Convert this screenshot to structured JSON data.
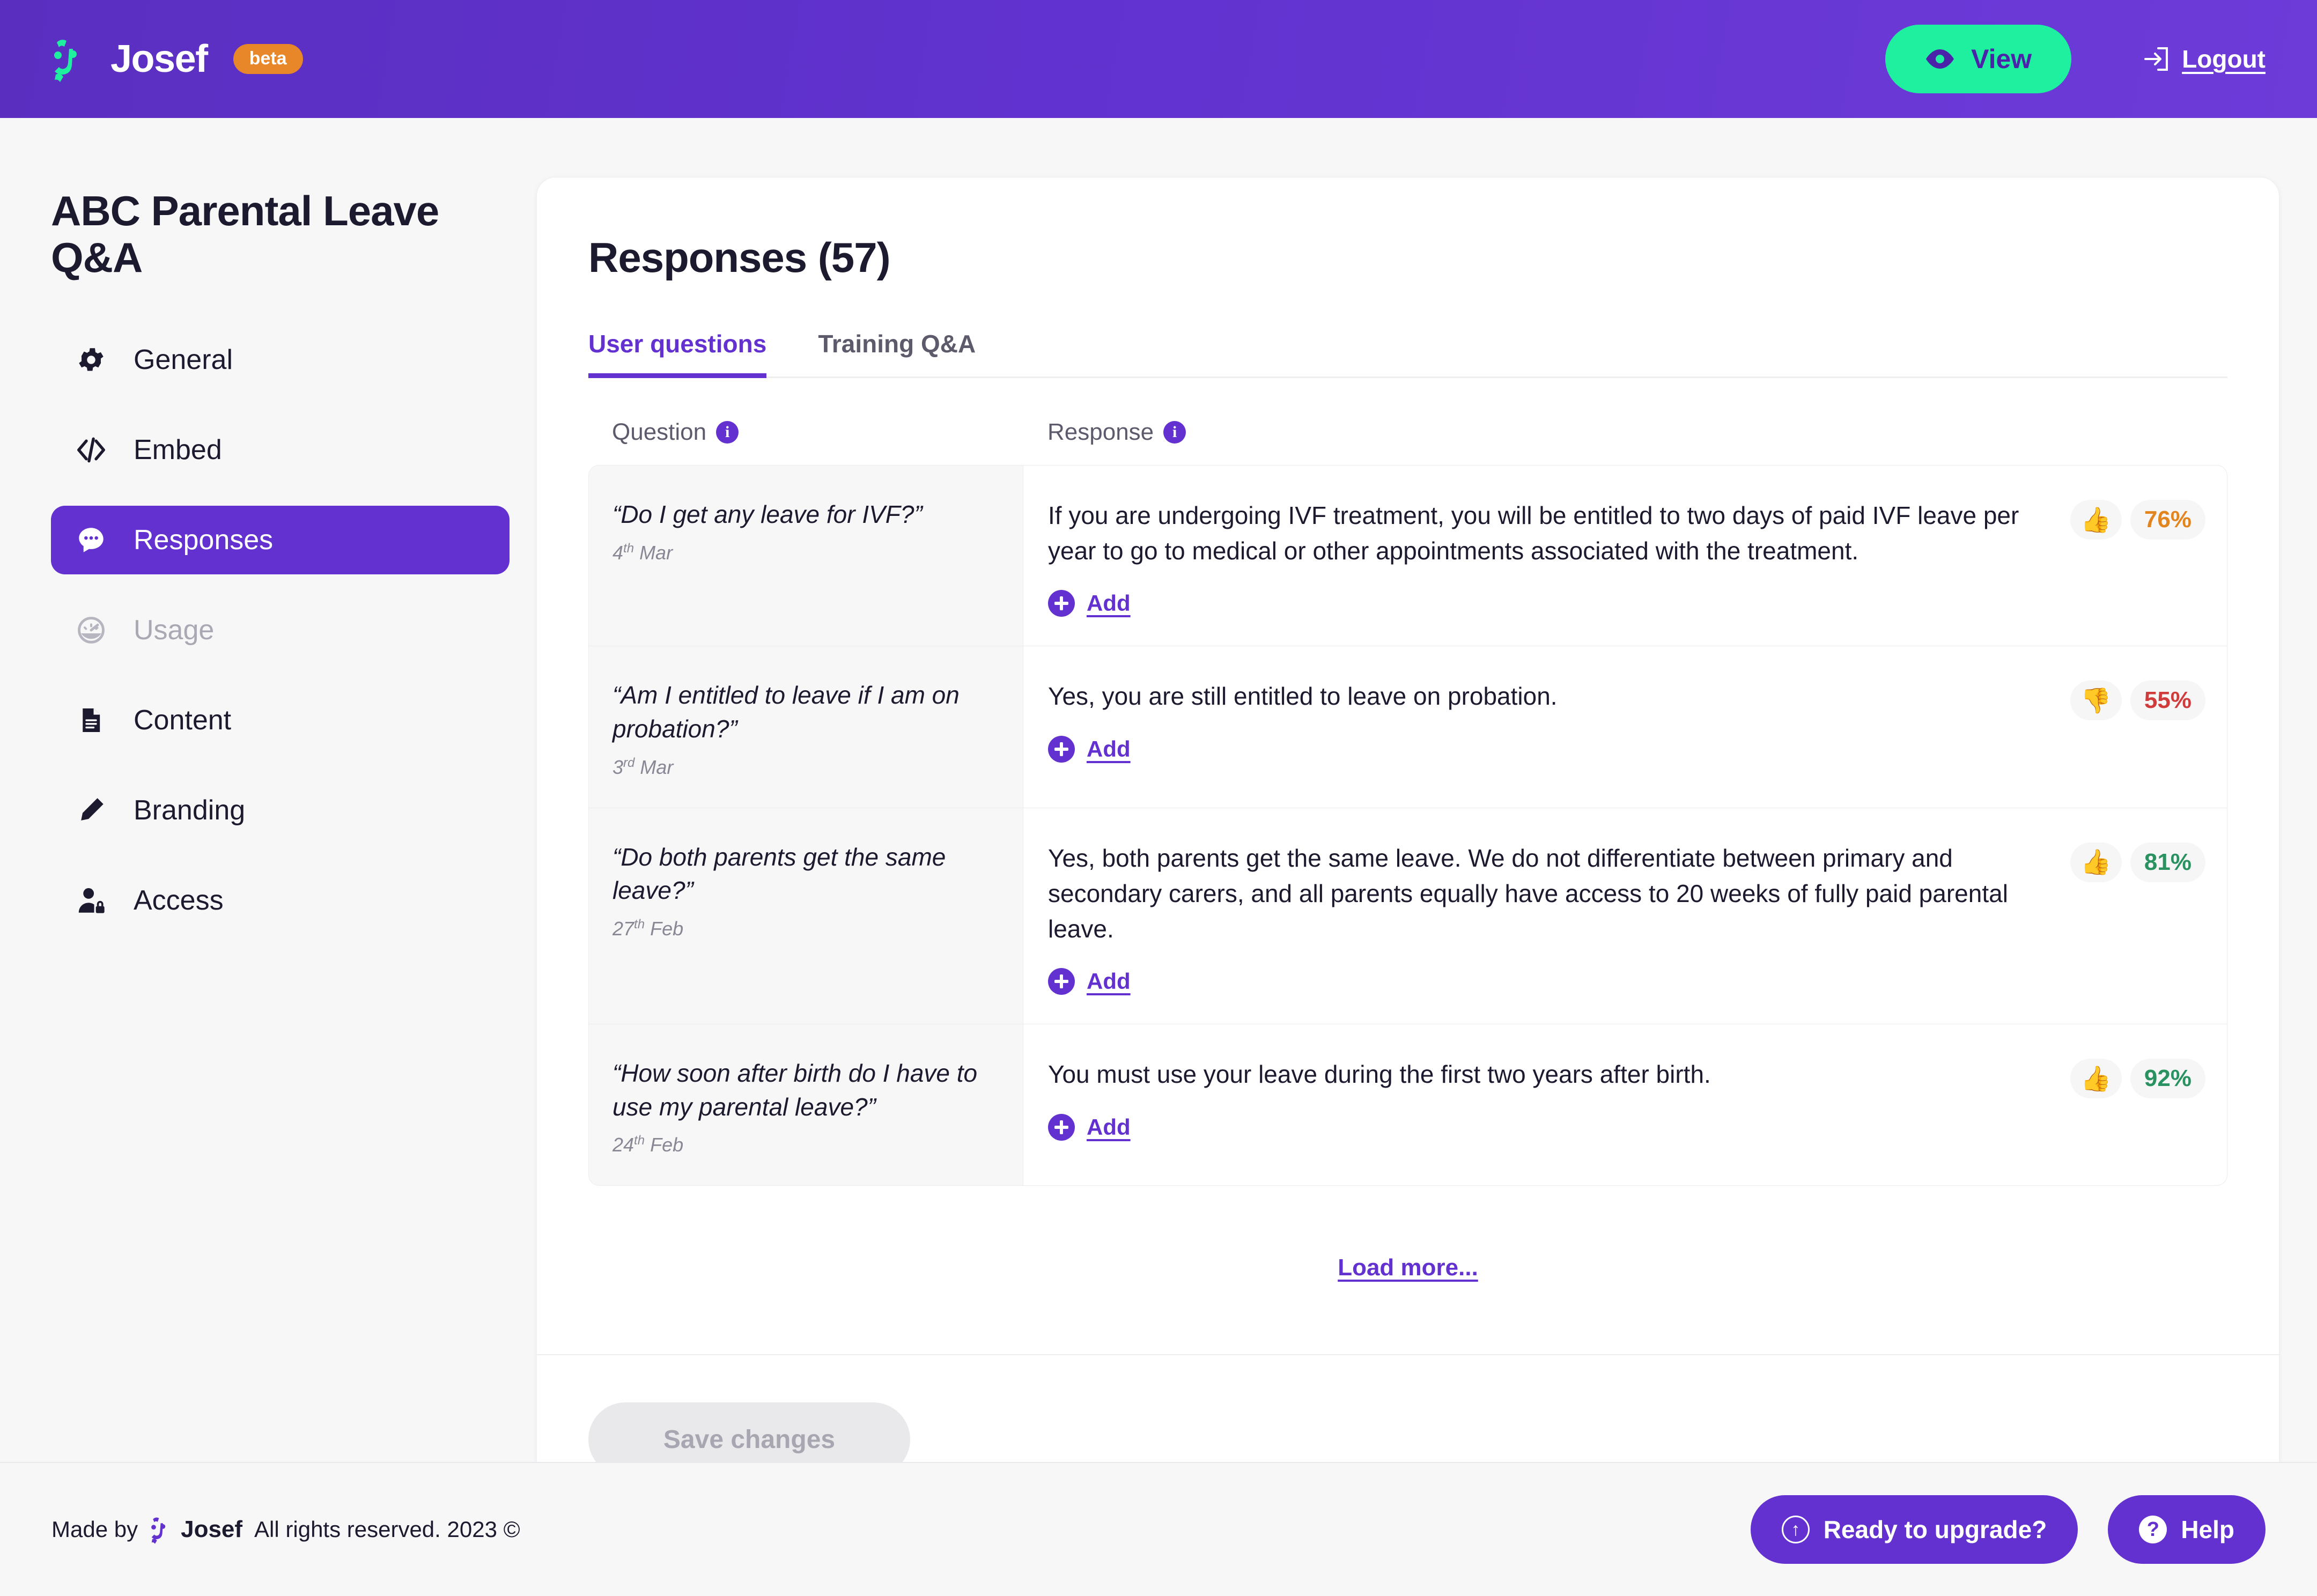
{
  "topbar": {
    "brand_name": "Josef",
    "beta_label": "beta",
    "view_label": "View",
    "logout_label": "Logout",
    "accent_green": "#1ef0a0",
    "brand_purple": "#6331cf",
    "beta_orange": "#e8862a"
  },
  "sidebar": {
    "project_title": "ABC Parental Leave Q&A",
    "items": [
      {
        "label": "General",
        "icon": "gear-icon",
        "state": "normal"
      },
      {
        "label": "Embed",
        "icon": "code-icon",
        "state": "normal"
      },
      {
        "label": "Responses",
        "icon": "chat-icon",
        "state": "active"
      },
      {
        "label": "Usage",
        "icon": "gauge-icon",
        "state": "disabled"
      },
      {
        "label": "Content",
        "icon": "document-icon",
        "state": "normal"
      },
      {
        "label": "Branding",
        "icon": "pencil-icon",
        "state": "normal"
      },
      {
        "label": "Access",
        "icon": "user-lock-icon",
        "state": "normal"
      }
    ]
  },
  "main": {
    "title": "Responses (57)",
    "response_count": 57,
    "tabs": [
      {
        "label": "User questions",
        "active": true
      },
      {
        "label": "Training Q&A",
        "active": false
      }
    ],
    "columns": [
      {
        "label": "Question",
        "info": "i"
      },
      {
        "label": "Response",
        "info": "i"
      }
    ],
    "add_label": "Add",
    "rows": [
      {
        "question": "“Do I get any leave for IVF?”",
        "date_day": "4",
        "date_suffix": "th",
        "date_month": "Mar",
        "response": "If you are undergoing IVF treatment, you will be entitled to two days of paid IVF leave per year to go to medical or other appointments associated with the treatment.",
        "thumb": "👍",
        "thumb_kind": "thumbs-up",
        "percent": "76%",
        "percent_color": "#e3851f"
      },
      {
        "question": "“Am I entitled to leave if I am on probation?”",
        "date_day": "3",
        "date_suffix": "rd",
        "date_month": "Mar",
        "response": "Yes, you are still entitled to leave on probation.",
        "thumb": "👎",
        "thumb_kind": "thumbs-down",
        "percent": "55%",
        "percent_color": "#d03c3c"
      },
      {
        "question": "“Do both parents get the same leave?”",
        "date_day": "27",
        "date_suffix": "th",
        "date_month": "Feb",
        "response": "Yes, both parents get the same leave. We do not differentiate between primary and secondary carers, and all parents equally have access to 20 weeks of fully paid parental leave.",
        "thumb": "👍",
        "thumb_kind": "thumbs-up",
        "percent": "81%",
        "percent_color": "#2a9160"
      },
      {
        "question": "“How soon after birth do I have to use my parental leave?”",
        "date_day": "24",
        "date_suffix": "th",
        "date_month": "Feb",
        "response": "You must use your leave during the first two years after birth.",
        "thumb": "👍",
        "thumb_kind": "thumbs-up",
        "percent": "92%",
        "percent_color": "#2a9160"
      }
    ],
    "load_more_label": "Load more...",
    "save_label": "Save changes"
  },
  "footer": {
    "made_by": "Made by",
    "brand_name": "Josef",
    "rights": "All rights reserved. 2023 ©",
    "upgrade_label": "Ready to upgrade?",
    "help_label": "Help"
  }
}
